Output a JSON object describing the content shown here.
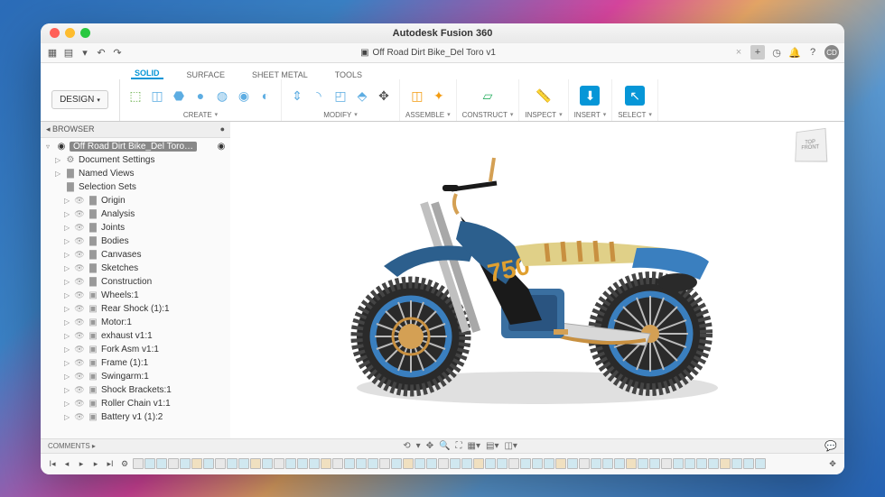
{
  "titlebar": {
    "title": "Autodesk Fusion 360"
  },
  "document": {
    "name": "Off Road Dirt Bike_Del Toro v1"
  },
  "user_badge": "CD",
  "workspace": {
    "label": "DESIGN"
  },
  "ribbon_tabs": [
    {
      "label": "SOLID",
      "active": true
    },
    {
      "label": "SURFACE",
      "active": false
    },
    {
      "label": "SHEET METAL",
      "active": false
    },
    {
      "label": "TOOLS",
      "active": false
    }
  ],
  "ribbon_groups": [
    {
      "label": "CREATE",
      "has_caret": true
    },
    {
      "label": "MODIFY",
      "has_caret": true
    },
    {
      "label": "ASSEMBLE",
      "has_caret": true
    },
    {
      "label": "CONSTRUCT",
      "has_caret": true
    },
    {
      "label": "INSPECT",
      "has_caret": true
    },
    {
      "label": "INSERT",
      "has_caret": true
    },
    {
      "label": "SELECT",
      "has_caret": true
    }
  ],
  "browser": {
    "title": "BROWSER",
    "root": "Off Road Dirt Bike_Del Toro…",
    "nodes": [
      {
        "icon": "gear",
        "label": "Document Settings",
        "expand": true,
        "indent": 1
      },
      {
        "icon": "folder",
        "label": "Named Views",
        "expand": true,
        "indent": 1
      },
      {
        "icon": "folder",
        "label": "Selection Sets",
        "expand": false,
        "indent": 1
      },
      {
        "icon": "folder",
        "label": "Origin",
        "expand": true,
        "indent": 2,
        "eye": true
      },
      {
        "icon": "folder",
        "label": "Analysis",
        "expand": true,
        "indent": 2,
        "eye": true
      },
      {
        "icon": "folder",
        "label": "Joints",
        "expand": true,
        "indent": 2,
        "eye": true
      },
      {
        "icon": "folder",
        "label": "Bodies",
        "expand": true,
        "indent": 2,
        "eye": true
      },
      {
        "icon": "folder",
        "label": "Canvases",
        "expand": true,
        "indent": 2,
        "eye": true
      },
      {
        "icon": "folder",
        "label": "Sketches",
        "expand": true,
        "indent": 2,
        "eye": true
      },
      {
        "icon": "folder",
        "label": "Construction",
        "expand": true,
        "indent": 2,
        "eye": true
      },
      {
        "icon": "comp",
        "label": "Wheels:1",
        "expand": true,
        "indent": 2,
        "eye": true
      },
      {
        "icon": "comp",
        "label": "Rear Shock (1):1",
        "expand": true,
        "indent": 2,
        "eye": true
      },
      {
        "icon": "comp",
        "label": "Motor:1",
        "expand": true,
        "indent": 2,
        "eye": true
      },
      {
        "icon": "comp",
        "label": "exhaust v1:1",
        "expand": true,
        "indent": 2,
        "eye": true
      },
      {
        "icon": "comp",
        "label": "Fork Asm v1:1",
        "expand": true,
        "indent": 2,
        "eye": true
      },
      {
        "icon": "comp",
        "label": "Frame (1):1",
        "expand": true,
        "indent": 2,
        "eye": true
      },
      {
        "icon": "comp",
        "label": "Swingarm:1",
        "expand": true,
        "indent": 2,
        "eye": true
      },
      {
        "icon": "comp",
        "label": "Shock Brackets:1",
        "expand": true,
        "indent": 2,
        "eye": true
      },
      {
        "icon": "comp",
        "label": "Roller Chain v1:1",
        "expand": true,
        "indent": 2,
        "eye": true
      },
      {
        "icon": "comp",
        "label": "Battery v1 (1):2",
        "expand": true,
        "indent": 2,
        "eye": true
      }
    ]
  },
  "viewcube": {
    "top": "TOP",
    "front": "FRONT"
  },
  "comments": {
    "label": "COMMENTS"
  },
  "model_decal": "750"
}
